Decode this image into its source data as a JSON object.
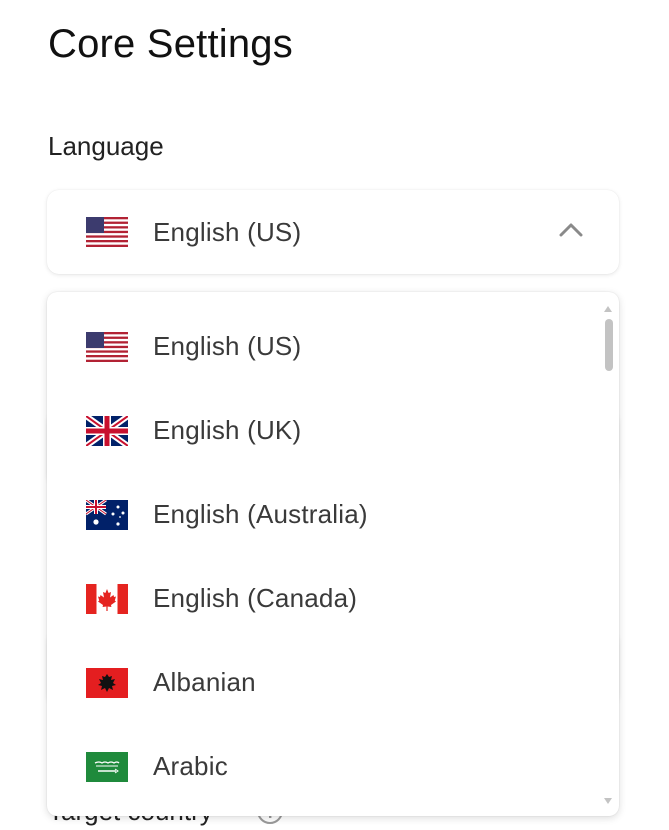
{
  "page": {
    "title": "Core Settings"
  },
  "language": {
    "label": "Language",
    "selected": {
      "label": "English (US)",
      "flag_icon": "us-flag-icon"
    },
    "expanded": true,
    "options": [
      {
        "label": "English (US)",
        "flag_icon": "us-flag-icon"
      },
      {
        "label": "English (UK)",
        "flag_icon": "uk-flag-icon"
      },
      {
        "label": "English (Australia)",
        "flag_icon": "australia-flag-icon"
      },
      {
        "label": "English (Canada)",
        "flag_icon": "canada-flag-icon"
      },
      {
        "label": "Albanian",
        "flag_icon": "albania-flag-icon"
      },
      {
        "label": "Arabic",
        "flag_icon": "saudi-arabia-flag-icon"
      }
    ]
  },
  "target_country": {
    "label": "Target country"
  },
  "colors": {
    "text": "#3a3a3a",
    "title": "#111111",
    "scroll_thumb": "#c3c3c3"
  }
}
